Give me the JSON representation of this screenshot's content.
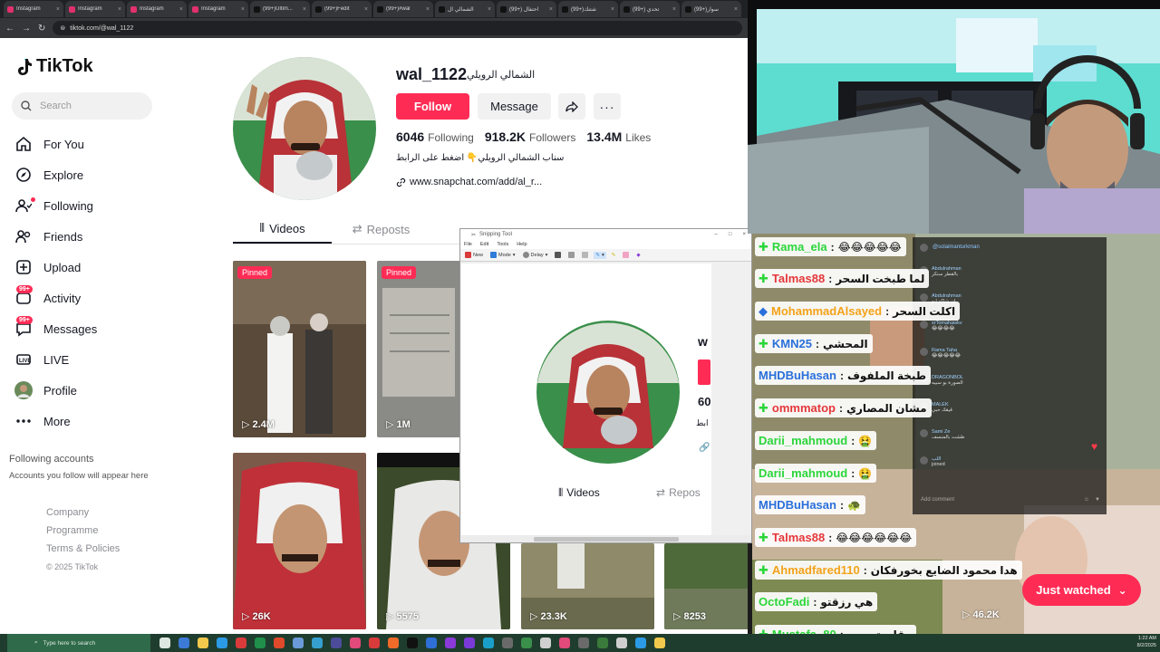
{
  "browser": {
    "tabs": [
      {
        "label": "Instagram",
        "color": "#e1306c"
      },
      {
        "label": "Instagram",
        "color": "#e1306c"
      },
      {
        "label": "Instagram",
        "color": "#e1306c"
      },
      {
        "label": "Instagram",
        "color": "#e1306c"
      },
      {
        "label": "(99+)Ultim...",
        "color": "#111111"
      },
      {
        "label": "(99+)Fedit",
        "color": "#111111"
      },
      {
        "label": "(99+)#wal",
        "color": "#111111"
      },
      {
        "label": "الشمالي ال",
        "color": "#111111"
      },
      {
        "label": "(99+) احتفال",
        "color": "#111111"
      },
      {
        "label": "(99+)شتنك",
        "color": "#111111"
      },
      {
        "label": "(99+) تحدي",
        "color": "#111111"
      },
      {
        "label": "(99+)سوار",
        "color": "#111111"
      }
    ],
    "tab_close": "×",
    "url": "tiktok.com/@wal_1122"
  },
  "tiktok": {
    "brand": "TikTok",
    "search_placeholder": "Search",
    "nav": [
      {
        "label": "For You",
        "icon": "home-icon"
      },
      {
        "label": "Explore",
        "icon": "compass-icon"
      },
      {
        "label": "Following",
        "icon": "following-icon"
      },
      {
        "label": "Friends",
        "icon": "friends-icon"
      },
      {
        "label": "Upload",
        "icon": "upload-icon"
      },
      {
        "label": "Activity",
        "icon": "activity-icon",
        "badge": "99+"
      },
      {
        "label": "Messages",
        "icon": "messages-icon",
        "badge": "99+"
      },
      {
        "label": "LIVE",
        "icon": "live-icon"
      },
      {
        "label": "Profile",
        "icon": "profile-avatar-icon"
      },
      {
        "label": "More",
        "icon": "more-icon"
      }
    ],
    "following_accounts": {
      "title": "Following accounts",
      "subtitle": "Accounts you follow will appear here"
    },
    "footer": {
      "links": [
        "Company",
        "Programme",
        "Terms & Policies"
      ],
      "copyright": "© 2025 TikTok"
    },
    "profile": {
      "username": "wal_1122",
      "nickname": "الشمالي الرويلي",
      "follow_label": "Follow",
      "message_label": "Message",
      "following_count": "6046",
      "following_label": "Following",
      "followers_count": "918.2K",
      "followers_label": "Followers",
      "likes_count": "13.4M",
      "likes_label": "Likes",
      "bio": "سناب الشمالي الرويلي👇 اضغط على الرابط",
      "link": "www.snapchat.com/add/al_r..."
    },
    "tabs": [
      {
        "label": "Videos"
      },
      {
        "label": "Reposts"
      }
    ],
    "videos": [
      {
        "views": "2.4M",
        "pinned": "Pinned"
      },
      {
        "views": "1M",
        "pinned": "Pinned"
      },
      {
        "views": "26K",
        "pinned": ""
      },
      {
        "views": "5575",
        "pinned": ""
      },
      {
        "views": "23.3K",
        "pinned": ""
      },
      {
        "views": "8253",
        "pinned": ""
      },
      {
        "views": "46.2K",
        "pinned": ""
      }
    ],
    "just_watched": "Just watched",
    "colors": {
      "accent": "#fe2c55"
    }
  },
  "snipping_tool": {
    "title": "Snipping Tool",
    "menu": [
      "File",
      "Edit",
      "Tools",
      "Help"
    ],
    "toolbar": {
      "new": "New",
      "mode": "Mode",
      "delay": "Delay"
    },
    "preview_username": "w",
    "preview_count": "60",
    "preview_bio": "ابط",
    "preview_tab_videos": "Videos",
    "preview_tab_reposts": "Repos"
  },
  "stream_chat": [
    {
      "name": "Rama_ela",
      "color": "#2bd63a",
      "msg": "😂😂😂😂😂",
      "emote": "gem"
    },
    {
      "name": "Talmas88",
      "color": "#e5373a",
      "msg": "لما طبخت السحر",
      "emote": "gem"
    },
    {
      "name": "MohammadAlsayed",
      "color": "#f4a21a",
      "msg": "اكلت السحر",
      "emote": "cube"
    },
    {
      "name": "KMN25",
      "color": "#2a6fdb",
      "msg": "المحشي",
      "emote": "gem"
    },
    {
      "name": "MHDBuHasan",
      "color": "#2a6fdb",
      "msg": "طبخة الملفوف",
      "emote": ""
    },
    {
      "name": "ommmatop",
      "color": "#e5373a",
      "msg": "مشان المصاري",
      "emote": "gem"
    },
    {
      "name": "Darii_mahmoud",
      "color": "#2bd63a",
      "msg": "🤮",
      "emote": ""
    },
    {
      "name": "Darii_mahmoud",
      "color": "#2bd63a",
      "msg": "🤮",
      "emote": ""
    },
    {
      "name": "MHDBuHasan",
      "color": "#2a6fdb",
      "msg": "🐢",
      "emote": ""
    },
    {
      "name": "Talmas88",
      "color": "#e5373a",
      "msg": "😂😂😂😂😂😂",
      "emote": "gem"
    },
    {
      "name": "Ahmadfared110",
      "color": "#f4a21a",
      "msg": "هدا محمود الضايع بخورفكان",
      "emote": "gem"
    },
    {
      "name": "OctoFadi",
      "color": "#2bd63a",
      "msg": "هي رزقتو",
      "emote": ""
    },
    {
      "name": "Mustafa_80",
      "color": "#2bd63a",
      "msg": "مقلوبة سحر",
      "emote": "gem"
    }
  ],
  "live_panel": {
    "host": "@solaimanturkman",
    "comments": [
      {
        "name": "Abdulrahman",
        "text": "بالقطر سنكر"
      },
      {
        "name": "Abdulrahman",
        "text": "ان شاكو ابو"
      },
      {
        "name": "srTomahawkv",
        "text": "😂😂😂😂"
      },
      {
        "name": "Rama Taha",
        "text": "😂😂😂😂😂"
      },
      {
        "name": "DRAGONBOL",
        "text": "الصورة بو سبيه"
      },
      {
        "name": "MALEK",
        "text": "قيقك حبي"
      },
      {
        "name": "Sami Ze",
        "text": "طشت بالمنسف"
      },
      {
        "name": "اللب",
        "text": "joined"
      }
    ],
    "add_comment": "Add comment"
  },
  "taskbar": {
    "search_placeholder": "Type here to search",
    "time": "1:22 AM",
    "date": "8/2/2025"
  }
}
